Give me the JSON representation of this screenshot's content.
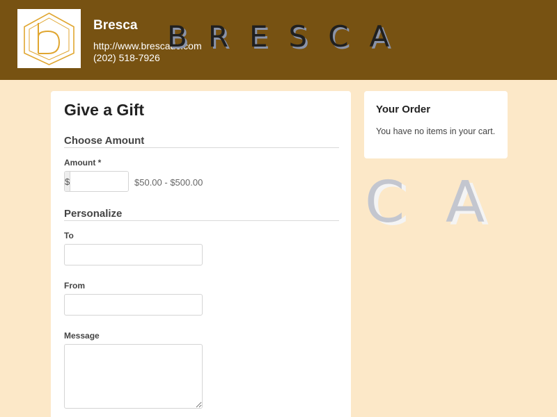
{
  "header": {
    "brand_name": "Bresca",
    "url": "http://www.brescadc.com",
    "phone": "(202) 518-7926",
    "wordmark": "BRESCA",
    "logo_icon": "bresca-b-hexagon-logo",
    "background_color": "#775212"
  },
  "decoration": {
    "letter_c": "C",
    "letter_a": "A"
  },
  "form": {
    "title": "Give a Gift",
    "amount_section": {
      "heading": "Choose Amount",
      "amount_label": "Amount *",
      "currency_prefix": "$",
      "amount_value": "",
      "range_text": "$50.00 - $500.00"
    },
    "personalize_section": {
      "heading": "Personalize",
      "to_label": "To",
      "to_value": "",
      "from_label": "From",
      "from_value": "",
      "message_label": "Message",
      "message_value": ""
    }
  },
  "order": {
    "title": "Your Order",
    "empty_text": "You have no items in your cart."
  },
  "colors": {
    "page_background": "#fce8c8",
    "header_background": "#775212",
    "logo_gold": "#e0a630"
  }
}
